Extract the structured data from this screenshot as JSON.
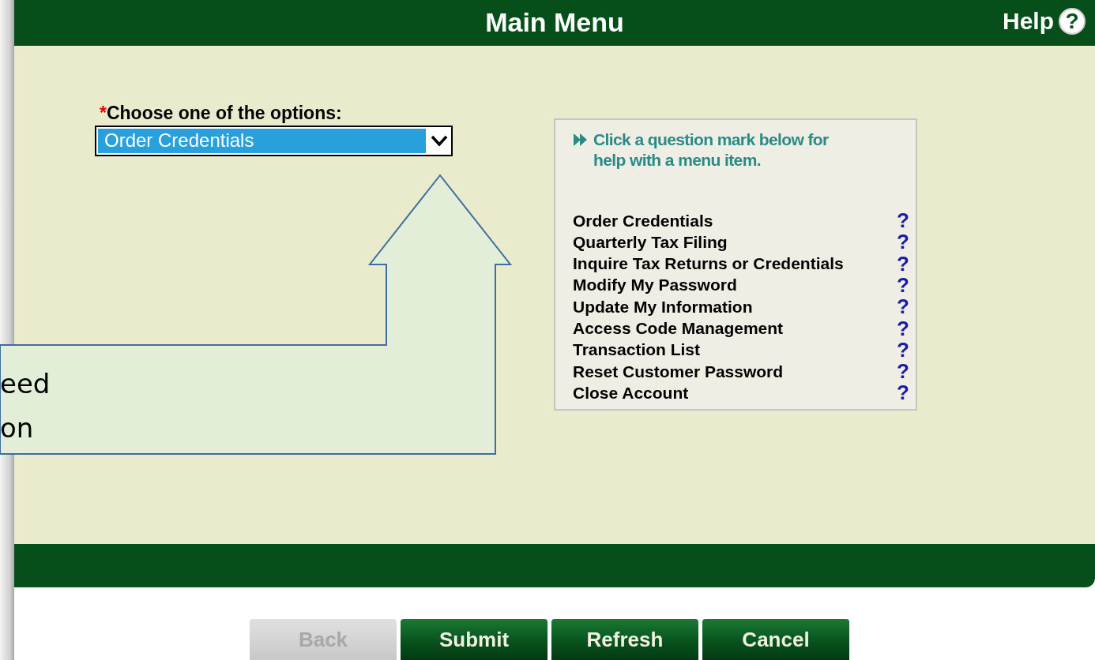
{
  "header": {
    "title": "Main Menu",
    "help_label": "Help",
    "help_icon": "?"
  },
  "form": {
    "required_mark": "*",
    "label": "Choose one of the options:",
    "select": {
      "value": "Order Credentials"
    }
  },
  "help_panel": {
    "intro": "Click a question mark below for help with a menu item.",
    "items": [
      {
        "label": "Order Credentials",
        "help": "?"
      },
      {
        "label": "Quarterly Tax Filing",
        "help": "?"
      },
      {
        "label": "Inquire Tax Returns or Credentials",
        "help": "?"
      },
      {
        "label": "Modify My Password",
        "help": "?"
      },
      {
        "label": "Update My Information",
        "help": "?"
      },
      {
        "label": "Access Code Management",
        "help": "?"
      },
      {
        "label": "Transaction List",
        "help": "?"
      },
      {
        "label": "Reset Customer Password",
        "help": "?"
      },
      {
        "label": "Close Account",
        "help": "?"
      }
    ]
  },
  "callout": {
    "lines": [
      "eed",
      "on"
    ]
  },
  "buttons": [
    {
      "label": "Back",
      "disabled": true
    },
    {
      "label": "Submit",
      "disabled": false
    },
    {
      "label": "Refresh",
      "disabled": false
    },
    {
      "label": "Cancel",
      "disabled": false
    }
  ]
}
